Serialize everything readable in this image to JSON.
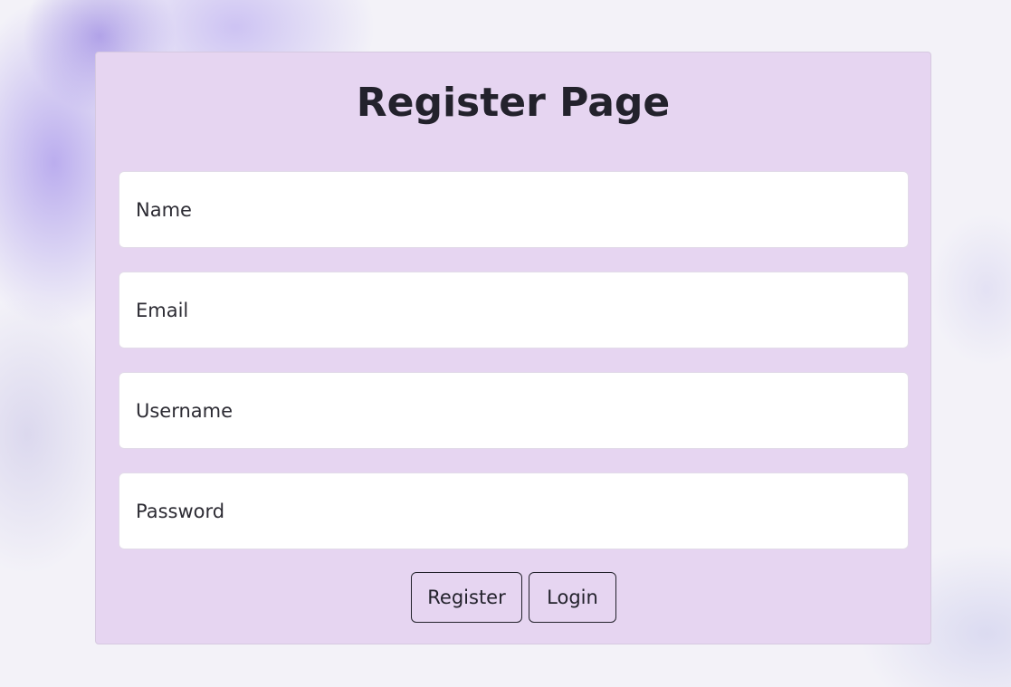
{
  "page": {
    "title": "Register Page"
  },
  "form": {
    "fields": [
      {
        "placeholder": "Name",
        "value": ""
      },
      {
        "placeholder": "Email",
        "value": ""
      },
      {
        "placeholder": "Username",
        "value": ""
      },
      {
        "placeholder": "Password",
        "value": ""
      }
    ],
    "register_label": "Register",
    "login_label": "Login"
  },
  "colors": {
    "card_background": "#e6d5f1",
    "text": "#23222c",
    "input_background": "#ffffff",
    "page_background": "#f3f2f8"
  }
}
